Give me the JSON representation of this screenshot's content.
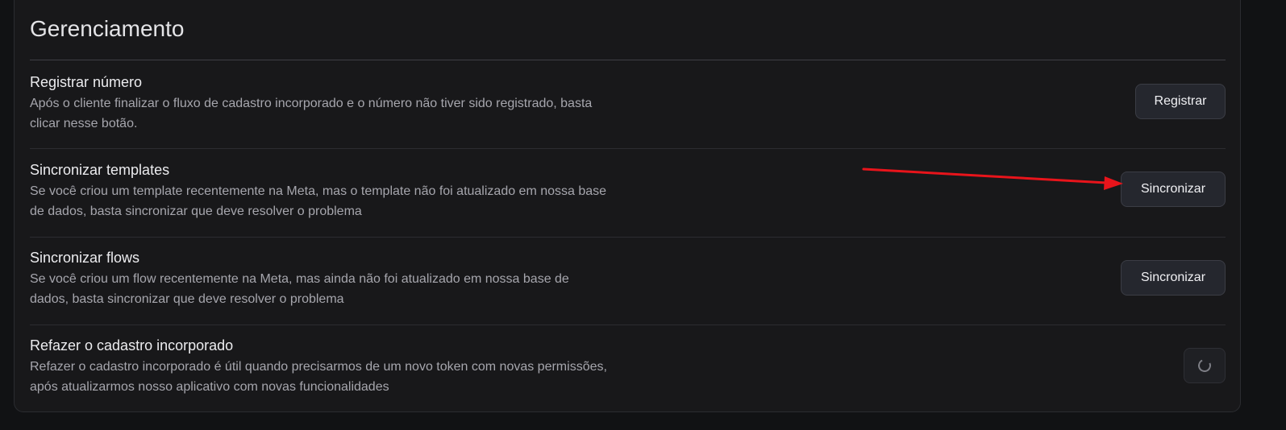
{
  "section": {
    "title": "Gerenciamento"
  },
  "rows": [
    {
      "title": "Registrar número",
      "description": "Após o cliente finalizar o fluxo de cadastro incorporado e o número não tiver sido registrado, basta clicar nesse botão.",
      "button_label": "Registrar"
    },
    {
      "title": "Sincronizar templates",
      "description": "Se você criou um template recentemente na Meta, mas o template não foi atualizado em nossa base de dados, basta sincronizar que deve resolver o problema",
      "button_label": "Sincronizar"
    },
    {
      "title": "Sincronizar flows",
      "description": "Se você criou um flow recentemente na Meta, mas ainda não foi atualizado em nossa base de dados, basta sincronizar que deve resolver o problema",
      "button_label": "Sincronizar"
    },
    {
      "title": "Refazer o cadastro incorporado",
      "description": "Refazer o cadastro incorporado é útil quando precisarmos de um novo token com novas permissões, após atualizarmos nosso aplicativo com novas funcionalidades",
      "button_state": "loading"
    }
  ],
  "colors": {
    "background": "#111214",
    "card": "#18181a",
    "button": "#25272e",
    "annotation_arrow": "#e8141b"
  },
  "icons": {
    "loading": "spinner-icon"
  }
}
